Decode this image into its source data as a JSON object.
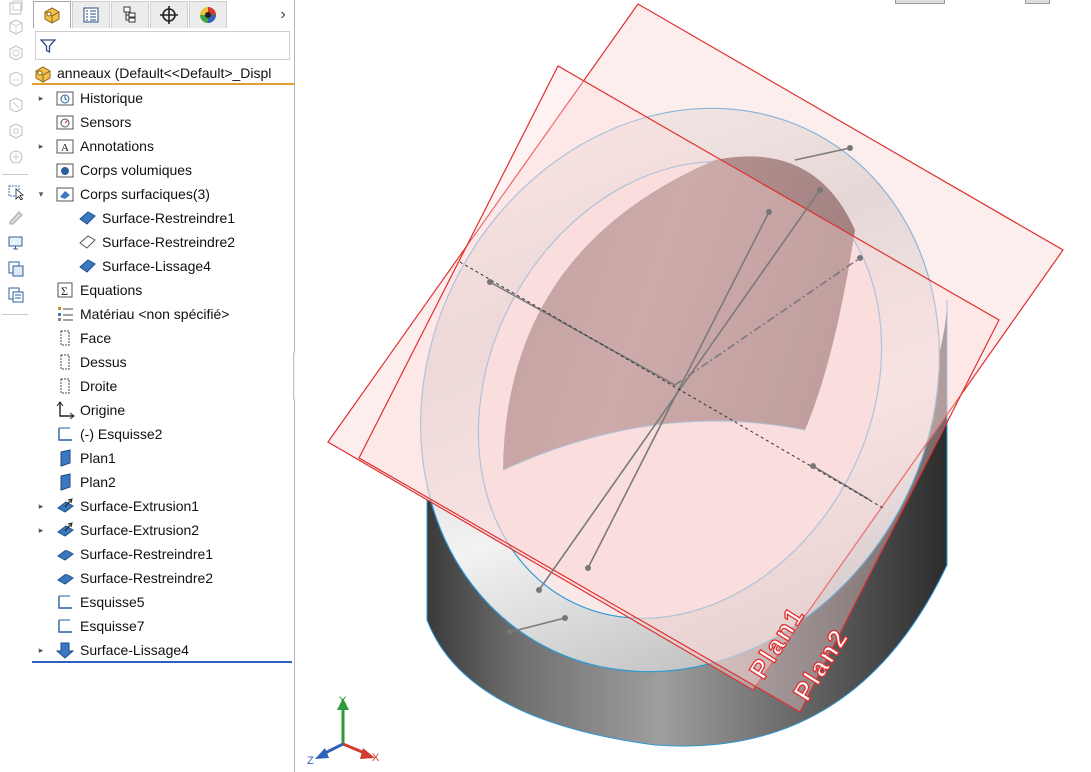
{
  "left_toolbar": {
    "icons": [
      "part-icon-1",
      "part-icon-2",
      "part-icon-3",
      "part-icon-4",
      "part-icon-5",
      "part-icon-6",
      "part-icon-7",
      "select-icon",
      "edit-icon",
      "display-icon",
      "copy-icon",
      "paste-icon"
    ]
  },
  "tabs": [
    {
      "icon": "featuremanager-icon",
      "active": true
    },
    {
      "icon": "propertymanager-icon",
      "active": false
    },
    {
      "icon": "configurationmanager-icon",
      "active": false
    },
    {
      "icon": "dimxpert-icon",
      "active": false
    },
    {
      "icon": "displaymanager-icon",
      "active": false
    }
  ],
  "tab_more": "›",
  "filter": {
    "icon": "filter-icon"
  },
  "tree": {
    "root_label": "anneaux  (Default<<Default>_Displ",
    "items": [
      {
        "label": "Historique",
        "icon": "history-icon",
        "expander": "▸",
        "indent": 0
      },
      {
        "label": "Sensors",
        "icon": "sensors-icon",
        "expander": "",
        "indent": 0
      },
      {
        "label": "Annotations",
        "icon": "annotations-icon",
        "expander": "▸",
        "indent": 0
      },
      {
        "label": "Corps volumiques",
        "icon": "solid-bodies-icon",
        "expander": "",
        "indent": 0
      },
      {
        "label": "Corps surfaciques(3)",
        "icon": "surface-bodies-icon",
        "expander": "▾",
        "indent": 0
      },
      {
        "label": "Surface-Restreindre1",
        "icon": "surface-body-icon",
        "expander": "",
        "indent": 1
      },
      {
        "label": "Surface-Restreindre2",
        "icon": "surface-body-outline-icon",
        "expander": "",
        "indent": 1
      },
      {
        "label": "Surface-Lissage4",
        "icon": "surface-body-icon",
        "expander": "",
        "indent": 1
      },
      {
        "label": "Equations",
        "icon": "equations-icon",
        "expander": "",
        "indent": 0
      },
      {
        "label": "Matériau <non spécifié>",
        "icon": "material-icon",
        "expander": "",
        "indent": 0
      },
      {
        "label": "Face",
        "icon": "plane-icon",
        "expander": "",
        "indent": 0
      },
      {
        "label": "Dessus",
        "icon": "plane-icon",
        "expander": "",
        "indent": 0
      },
      {
        "label": "Droite",
        "icon": "plane-icon",
        "expander": "",
        "indent": 0
      },
      {
        "label": "Origine",
        "icon": "origin-icon",
        "expander": "",
        "indent": 0
      },
      {
        "label": "(-) Esquisse2",
        "icon": "sketch-icon",
        "expander": "",
        "indent": 0
      },
      {
        "label": "Plan1",
        "icon": "ref-plane-icon",
        "expander": "",
        "indent": 0
      },
      {
        "label": "Plan2",
        "icon": "ref-plane-icon",
        "expander": "",
        "indent": 0
      },
      {
        "label": "Surface-Extrusion1",
        "icon": "surface-extrude-icon",
        "expander": "▸",
        "indent": 0
      },
      {
        "label": "Surface-Extrusion2",
        "icon": "surface-extrude-icon",
        "expander": "▸",
        "indent": 0
      },
      {
        "label": "Surface-Restreindre1",
        "icon": "surface-trim-icon",
        "expander": "",
        "indent": 0
      },
      {
        "label": "Surface-Restreindre2",
        "icon": "surface-trim-icon",
        "expander": "",
        "indent": 0
      },
      {
        "label": "Esquisse5",
        "icon": "sketch-icon",
        "expander": "",
        "indent": 0
      },
      {
        "label": "Esquisse7",
        "icon": "sketch-icon",
        "expander": "",
        "indent": 0
      },
      {
        "label": "Surface-Lissage4",
        "icon": "surface-loft-icon",
        "expander": "▸",
        "indent": 0
      }
    ]
  },
  "viewport": {
    "plane_labels": {
      "plan1": "Plan1",
      "plan2": "Plan2"
    },
    "triad": {
      "x": "X",
      "y": "Y",
      "z": "Z"
    },
    "colors": {
      "plane_edge": "#e03030",
      "plane_fill": "#fbdada",
      "body_edge": "#2a9ad6"
    }
  }
}
